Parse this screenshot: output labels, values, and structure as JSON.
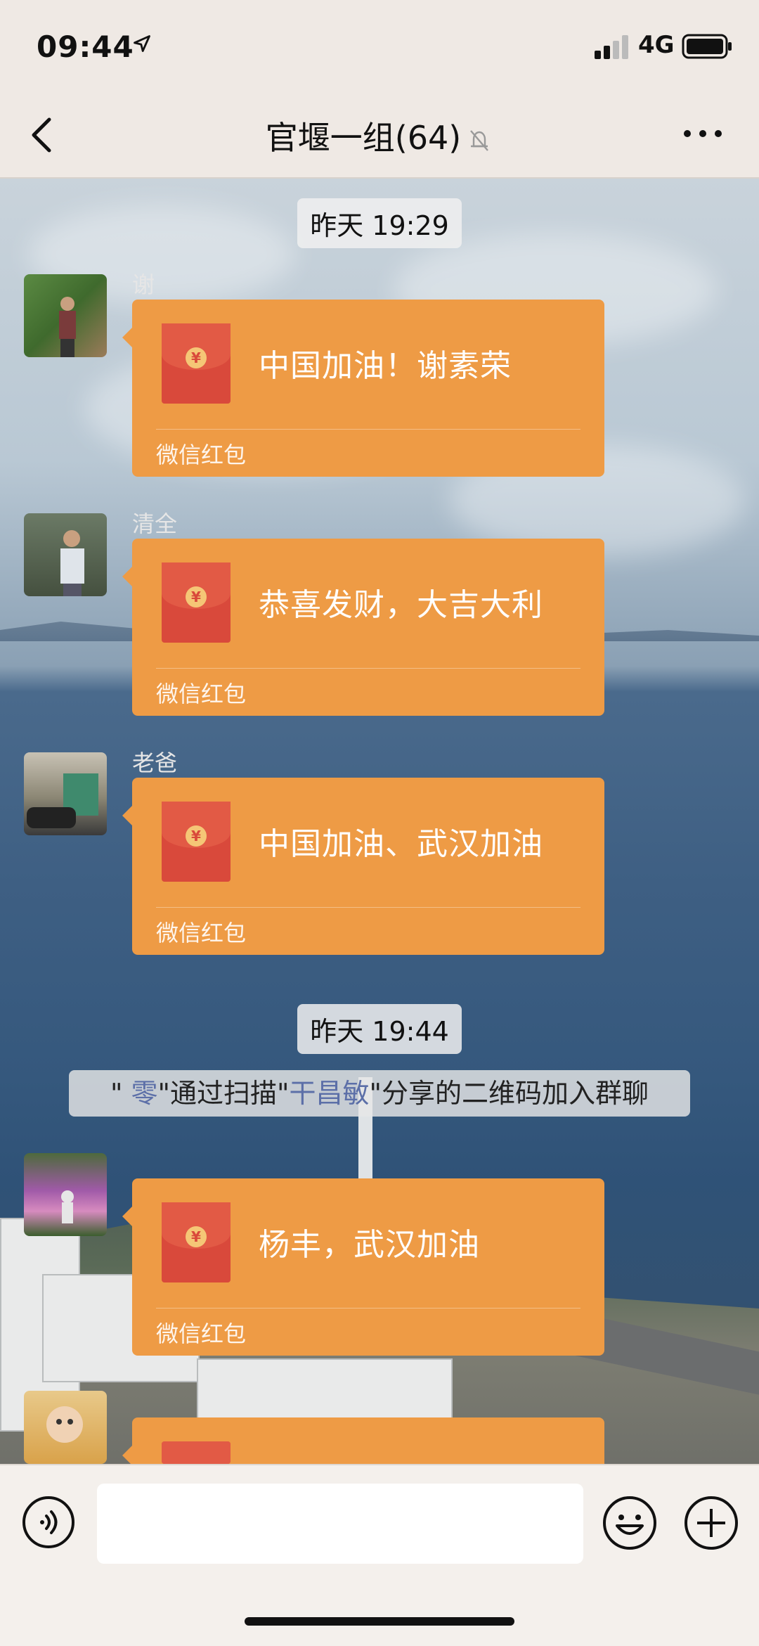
{
  "status_bar": {
    "time": "09:44",
    "network": "4G"
  },
  "header": {
    "title": "官堰一组(64)"
  },
  "messages": [
    {
      "sender": "谢",
      "type": "red-packet",
      "text": "中国加油！谢素荣",
      "label": "微信红包"
    },
    {
      "sender": "清全",
      "type": "red-packet",
      "text": "恭喜发财，大吉大利",
      "label": "微信红包"
    },
    {
      "sender": "老爸",
      "type": "red-packet",
      "text": "中国加油、武汉加油",
      "label": "微信红包"
    },
    {
      "sender": "",
      "type": "red-packet",
      "text": "杨丰，武汉加油",
      "label": "微信红包"
    }
  ],
  "timestamps": [
    "昨天 19:29",
    "昨天 19:44"
  ],
  "system_message": {
    "q1": "\" ",
    "user": "零",
    "part2": "\"通过扫描\"",
    "inviter": "干昌敏",
    "part3": "\"分享的二维码加入群聊"
  },
  "input": {
    "value": ""
  },
  "colors": {
    "red_packet": "#ee9b45",
    "envelope": "#d9493b",
    "link": "#5c6fa8"
  },
  "icons": [
    "back-icon",
    "mute-bell-icon",
    "more-icon",
    "voice-icon",
    "emoji-icon",
    "plus-icon",
    "location-arrow-icon",
    "signal-icon",
    "battery-icon"
  ]
}
